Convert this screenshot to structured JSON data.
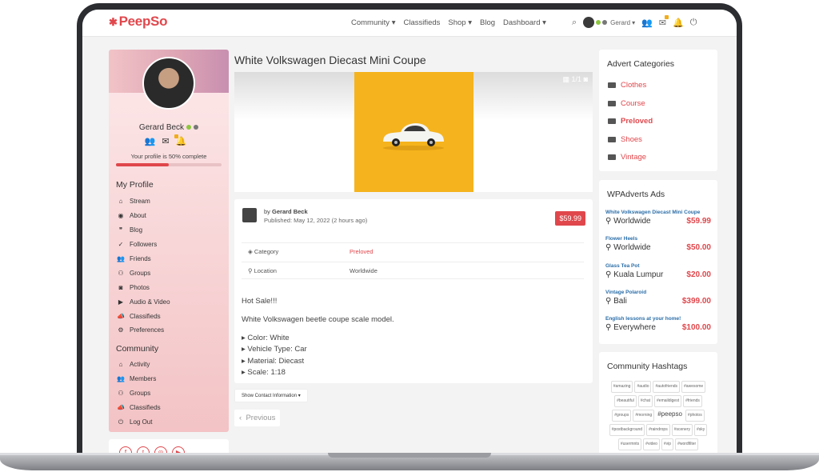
{
  "brand": {
    "logo": "PeepSo",
    "accent": "#e0474c"
  },
  "nav": {
    "items": [
      "Community",
      "Classifieds",
      "Shop",
      "Blog",
      "Dashboard"
    ],
    "user_name": "Gerard"
  },
  "profile": {
    "name": "Gerard Beck",
    "completion_text": "Your profile is 50% complete",
    "completion_fraction": 0.5,
    "my_profile_heading": "My Profile",
    "my_profile_items": [
      {
        "icon": "home-icon",
        "label": "Stream"
      },
      {
        "icon": "user-circle-icon",
        "label": "About"
      },
      {
        "icon": "quote-icon",
        "label": "Blog"
      },
      {
        "icon": "user-check-icon",
        "label": "Followers"
      },
      {
        "icon": "users-icon",
        "label": "Friends"
      },
      {
        "icon": "group-icon",
        "label": "Groups"
      },
      {
        "icon": "camera-icon",
        "label": "Photos"
      },
      {
        "icon": "video-icon",
        "label": "Audio & Video"
      },
      {
        "icon": "bullhorn-icon",
        "label": "Classifieds"
      },
      {
        "icon": "gear-icon",
        "label": "Preferences"
      }
    ],
    "community_heading": "Community",
    "community_items": [
      {
        "icon": "home-icon",
        "label": "Activity"
      },
      {
        "icon": "users-icon",
        "label": "Members"
      },
      {
        "icon": "group-icon",
        "label": "Groups"
      },
      {
        "icon": "bullhorn-icon",
        "label": "Classifieds"
      },
      {
        "icon": "power-icon",
        "label": "Log Out"
      }
    ]
  },
  "listing": {
    "title": "White Volkswagen Diecast Mini Coupe",
    "gallery_counter": "1/1",
    "seller_prefix": "by ",
    "seller": "Gerard Beck",
    "published": "Published: May 12, 2022 (2 hours ago)",
    "price": "$59.99",
    "category_label": "Category",
    "category_value": "Preloved",
    "location_label": "Location",
    "location_value": "Worldwide",
    "headline": "Hot Sale!!!",
    "description": "White Volkswagen beetle coupe scale model.",
    "specs": [
      "Color: White",
      "Vehicle Type: Car",
      "Material: Diecast",
      "Scale: 1:18"
    ],
    "contact_button": "Show Contact Information",
    "previous": "Previous"
  },
  "advert_categories": {
    "heading": "Advert Categories",
    "items": [
      "Clothes",
      "Course",
      "Preloved",
      "Shoes",
      "Vintage"
    ]
  },
  "wpadverts": {
    "heading": "WPAdverts Ads",
    "ads": [
      {
        "title": "White Volkswagen Diecast Mini Coupe",
        "location": "Worldwide",
        "price": "$59.99"
      },
      {
        "title": "Flower Heels",
        "location": "Worldwide",
        "price": "$50.00"
      },
      {
        "title": "Glass Tea Pot",
        "location": "Kuala Lumpur",
        "price": "$20.00"
      },
      {
        "title": "Vintage Polaroid",
        "location": "Bali",
        "price": "$399.00"
      },
      {
        "title": "English lessons at your home!",
        "location": "Everywhere",
        "price": "$100.00"
      }
    ]
  },
  "hashtags": {
    "heading": "Community Hashtags",
    "tags": [
      "#amazing",
      "#audio",
      "#autofriends",
      "#awesome",
      "#beautiful",
      "#chat",
      "#emaildigest",
      "#friends",
      "#groups",
      "#morning",
      "#peepso",
      "#photos",
      "#postbackground",
      "#raindrops",
      "#scenery",
      "#sky",
      "#usermnts",
      "#video",
      "#vip",
      "#wordfilter"
    ]
  }
}
